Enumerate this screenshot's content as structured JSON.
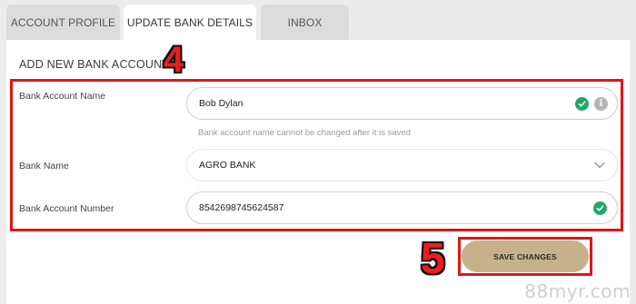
{
  "tabs": [
    {
      "label": "ACCOUNT PROFILE",
      "active": false
    },
    {
      "label": "UPDATE BANK DETAILS",
      "active": true
    },
    {
      "label": "INBOX",
      "active": false
    }
  ],
  "section_title": "ADD NEW BANK ACCOUNT",
  "steps": {
    "step4": "4",
    "step5": "5"
  },
  "form": {
    "bank_account_name": {
      "label": "Bank Account Name",
      "value": "Bob Dylan",
      "hint": "Bank account name cannot be changed after it is saved"
    },
    "bank_name": {
      "label": "Bank Name",
      "value": "AGRO BANK"
    },
    "bank_account_number": {
      "label": "Bank Account Number",
      "value": "8542698745624587"
    }
  },
  "save_button": "SAVE CHANGES",
  "watermark": "88myr.com",
  "icons": {
    "check": "check-circle-icon",
    "info": "info-icon",
    "chevron": "chevron-down-icon"
  },
  "colors": {
    "highlight": "#e01616",
    "check": "#26a567",
    "save_button": "#c6b18a"
  }
}
